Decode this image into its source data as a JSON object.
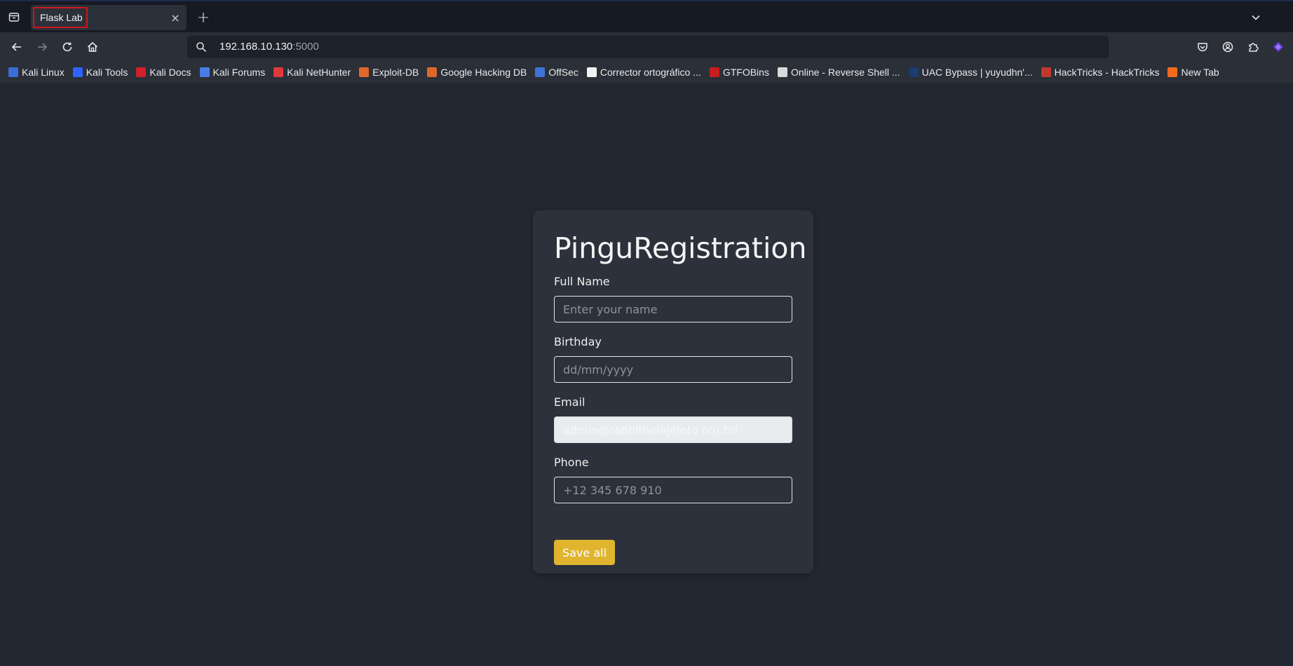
{
  "browser": {
    "tab": {
      "title": "Flask Lab",
      "close_glyph": "×"
    },
    "new_tab_glyph": "+",
    "url": {
      "host": "192.168.10.130",
      "port": ":5000"
    },
    "bookmarks": [
      {
        "label": "Kali Linux",
        "icon": "kali-dragon-icon",
        "color": "#3b6dd8"
      },
      {
        "label": "Kali Tools",
        "icon": "kali-tools-icon",
        "color": "#2f63ff"
      },
      {
        "label": "Kali Docs",
        "icon": "kali-docs-icon",
        "color": "#d0202a"
      },
      {
        "label": "Kali Forums",
        "icon": "kali-forums-icon",
        "color": "#4a7be8"
      },
      {
        "label": "Kali NetHunter",
        "icon": "nethunter-icon",
        "color": "#e03a3a"
      },
      {
        "label": "Exploit-DB",
        "icon": "exploit-db-icon",
        "color": "#e0672a"
      },
      {
        "label": "Google Hacking DB",
        "icon": "ghdb-icon",
        "color": "#e0672a"
      },
      {
        "label": "OffSec",
        "icon": "offsec-icon",
        "color": "#3f72d6"
      },
      {
        "label": "Corrector ortográfico ...",
        "icon": "corrector-icon",
        "color": "#f2f2f2"
      },
      {
        "label": "GTFOBins",
        "icon": "gtfobins-icon",
        "color": "#c81e1e"
      },
      {
        "label": "Online - Reverse Shell ...",
        "icon": "skull-icon",
        "color": "#d9d9d9"
      },
      {
        "label": "UAC Bypass | yuyudhn'...",
        "icon": "uac-bypass-icon",
        "color": "#1c3b6e"
      },
      {
        "label": "HackTricks - HackTricks",
        "icon": "hacktricks-icon",
        "color": "#c0392b"
      },
      {
        "label": "New Tab",
        "icon": "firefox-icon",
        "color": "#f26b1d"
      }
    ]
  },
  "form": {
    "title": "PinguRegistration",
    "fields": [
      {
        "label": "Full Name",
        "placeholder": "Enter your name",
        "value": ""
      },
      {
        "label": "Birthday",
        "placeholder": "dd/mm/yyyy",
        "value": ""
      },
      {
        "label": "Email",
        "placeholder": "",
        "value": "admin@rabbitholejeje(o no).tnl"
      },
      {
        "label": "Phone",
        "placeholder": "+12 345 678 910",
        "value": ""
      }
    ],
    "submit_label": "Save all"
  },
  "colors": {
    "page_bg": "#222831",
    "card_bg": "#2c313b",
    "accent_button": "#e0b42f",
    "tab_highlight": "#d01616"
  }
}
